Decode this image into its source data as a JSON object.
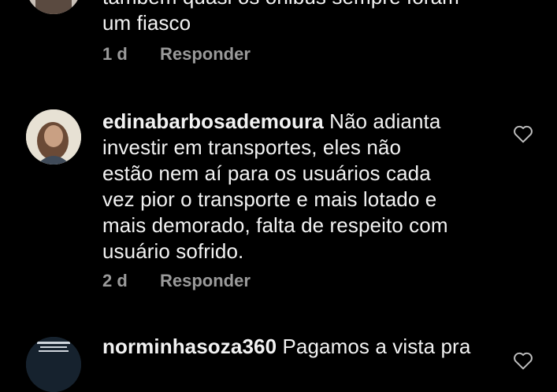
{
  "comments": [
    {
      "username": "",
      "text_lines": [
        "também quasi os ônibus sempre foram",
        "um fiasco"
      ],
      "time": "1 d",
      "reply_label": "Responder",
      "avatar_icon": "user-avatar"
    },
    {
      "username": "edinabarbosademoura",
      "text_lines": [
        "Não adianta",
        "investir em transportes, eles não",
        "estão nem aí para os usuários cada",
        "vez pior o transporte e mais lotado e",
        "mais demorado, falta de respeito com",
        "usuário sofrido."
      ],
      "time": "2 d",
      "reply_label": "Responder",
      "avatar_icon": "user-avatar",
      "like_icon": "heart-outline-icon"
    },
    {
      "username": "norminhasoza360",
      "text_lines": [
        "Pagamos a vista pra"
      ],
      "avatar_icon": "user-avatar",
      "like_icon": "heart-outline-icon"
    }
  ],
  "colors": {
    "background": "#000000",
    "text": "#f2f2f2",
    "meta": "#9a9a9a"
  }
}
